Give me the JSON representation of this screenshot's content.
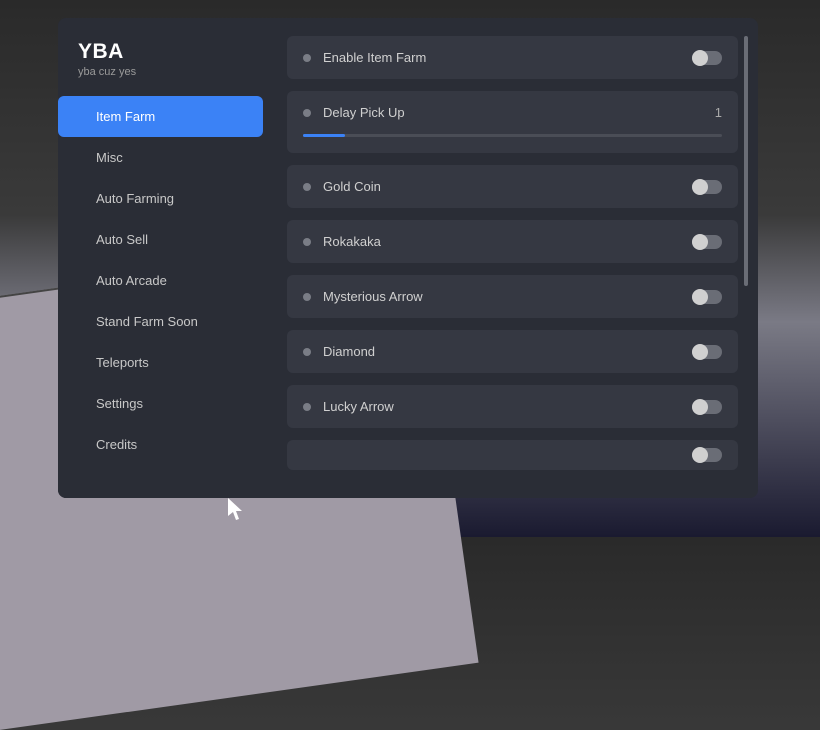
{
  "brand": {
    "title": "YBA",
    "subtitle": "yba cuz yes"
  },
  "sidebar": {
    "items": [
      {
        "label": "Item Farm",
        "active": true
      },
      {
        "label": "Misc"
      },
      {
        "label": "Auto Farming"
      },
      {
        "label": "Auto Sell"
      },
      {
        "label": "Auto Arcade"
      },
      {
        "label": "Stand Farm Soon"
      },
      {
        "label": "Teleports"
      },
      {
        "label": "Settings"
      },
      {
        "label": "Credits"
      }
    ]
  },
  "content": {
    "enable_item_farm": "Enable Item Farm",
    "delay_pick_up": "Delay Pick Up",
    "delay_value": "1",
    "gold_coin": "Gold Coin",
    "rokakaka": "Rokakaka",
    "mysterious_arrow": "Mysterious Arrow",
    "diamond": "Diamond",
    "lucky_arrow": "Lucky Arrow"
  },
  "colors": {
    "accent": "#3b82f6"
  }
}
